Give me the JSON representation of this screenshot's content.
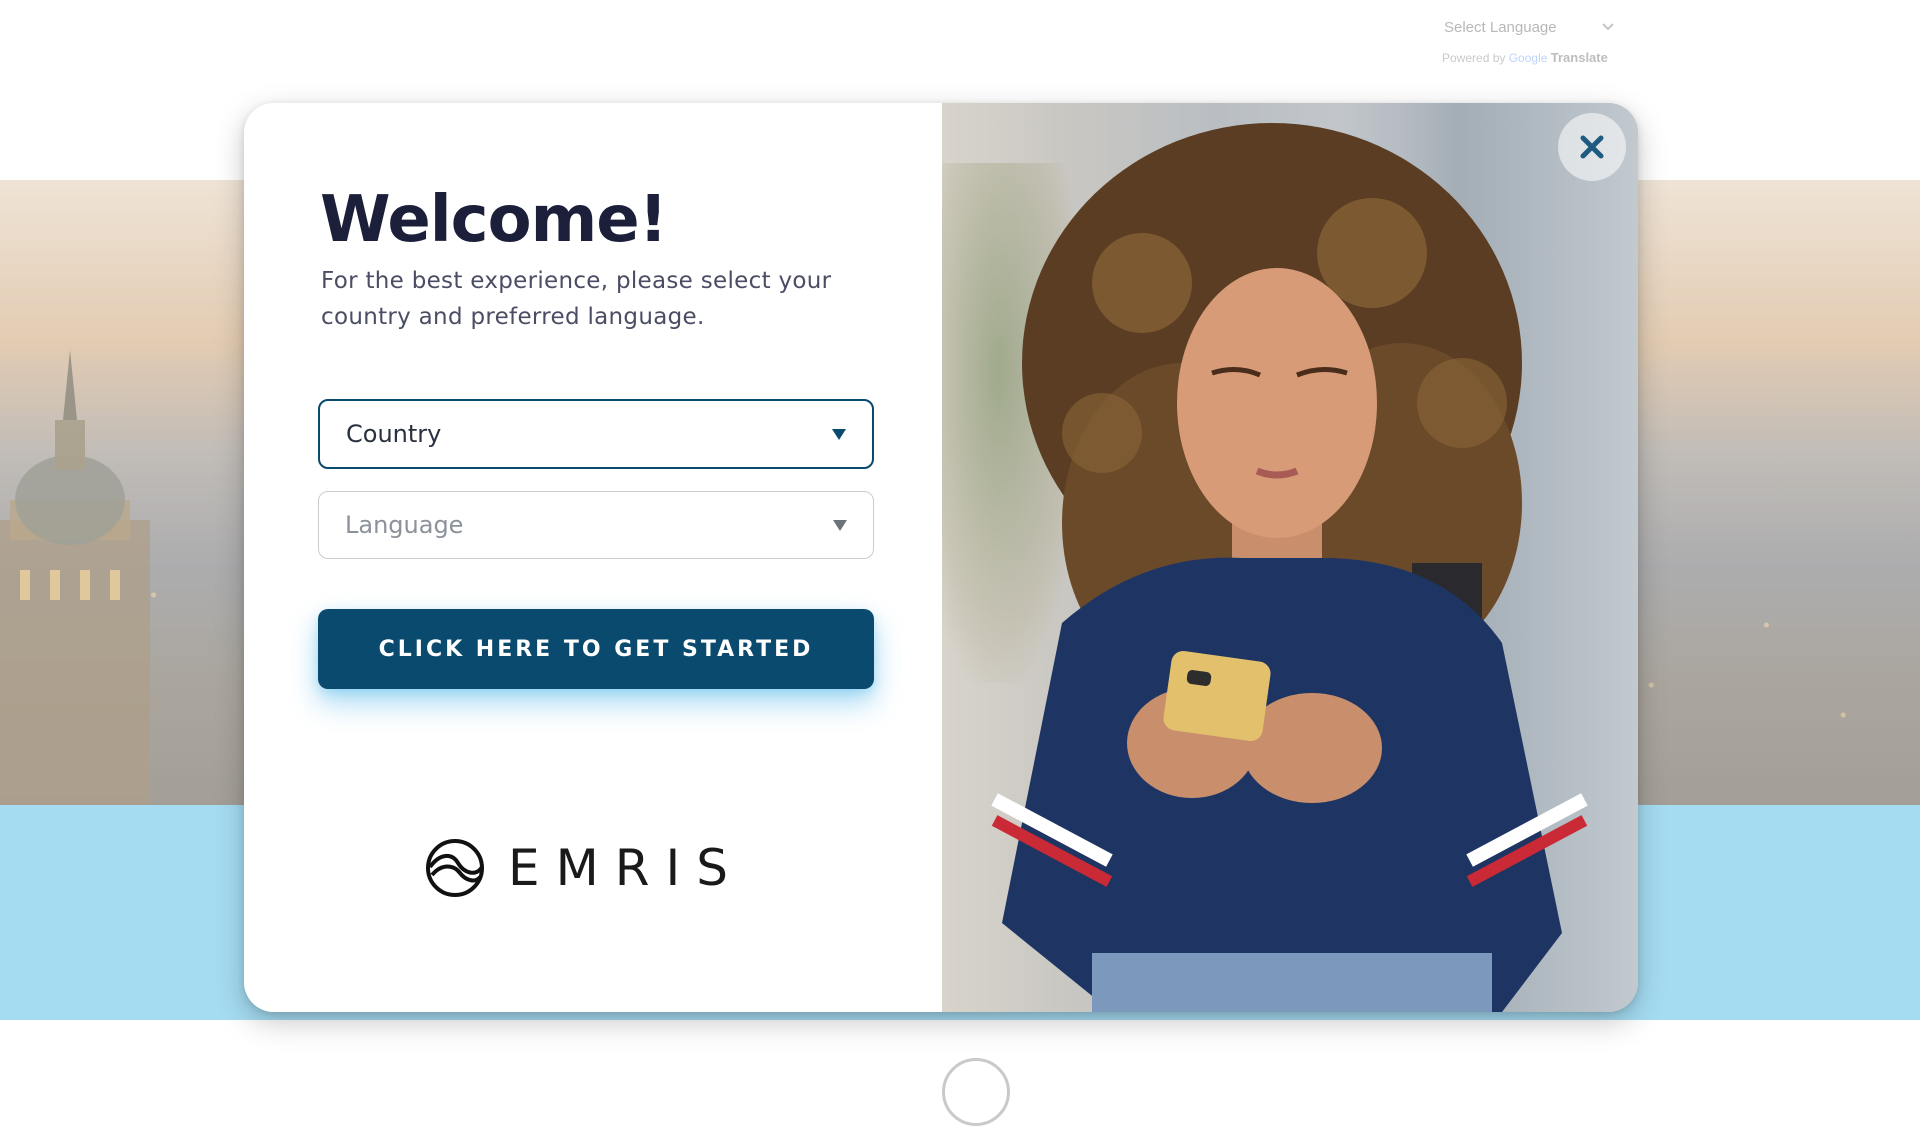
{
  "translate_widget": {
    "select_label": "Select Language",
    "powered_by": "Powered by",
    "google": "Google",
    "translate": "Translate"
  },
  "modal": {
    "title": "Welcome!",
    "subtitle": "For the best experience, please select your country and preferred language.",
    "country_select": {
      "selected": "Country"
    },
    "language_select": {
      "selected": "Language"
    },
    "cta_label": "Click here to get started",
    "brand_name": "EMRIS"
  },
  "colors": {
    "primary": "#0a4a6e",
    "title": "#1c1f3a",
    "band": "#a5dcf2",
    "cta_glow": "#40b0e8"
  },
  "icons": {
    "close": "close-icon",
    "caret": "caret-down-icon",
    "brand": "emris-logo-icon",
    "translate_chevron": "chevron-down-icon"
  }
}
